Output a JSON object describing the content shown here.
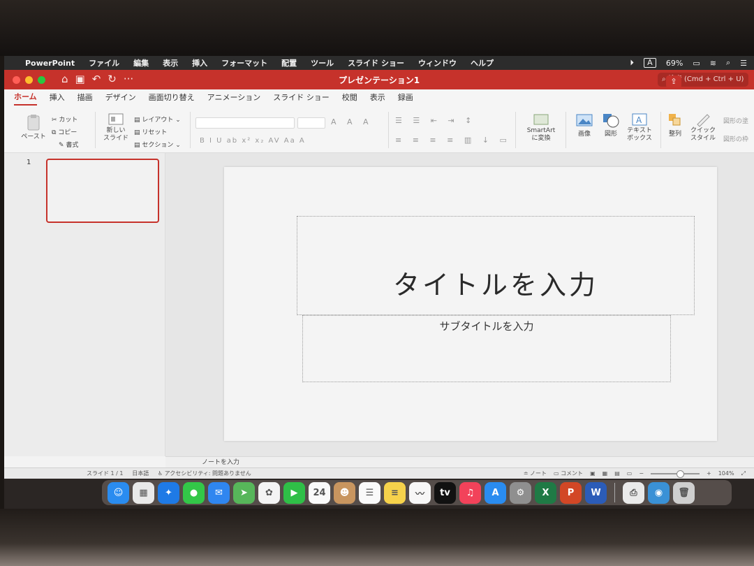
{
  "menubar": {
    "app_name": "PowerPoint",
    "items": [
      "ファイル",
      "編集",
      "表示",
      "挿入",
      "フォーマット",
      "配置",
      "ツール",
      "スライド ショー",
      "ウィンドウ",
      "ヘルプ"
    ],
    "input_indicator": "A",
    "battery": "69%"
  },
  "titlebar": {
    "document_title": "プレゼンテーション1",
    "search_placeholder": "検索 (Cmd + Ctrl + U)",
    "colors": {
      "accent": "#c6322b"
    }
  },
  "ribbon": {
    "tabs": [
      "ホーム",
      "挿入",
      "描画",
      "デザイン",
      "画面切り替え",
      "アニメーション",
      "スライド ショー",
      "校閲",
      "表示",
      "録画"
    ],
    "active_tab": "ホーム",
    "clipboard": {
      "paste": "ペースト",
      "cut": "カット",
      "copy": "コピー",
      "format": "書式"
    },
    "slides": {
      "new_slide_line1": "新しい",
      "new_slide_line2": "スライド",
      "layout": "レイアウト",
      "reset": "リセット",
      "section": "セクション"
    },
    "font_tools": "B  I  U  ab  x²  x₂  AV  Aa  A",
    "smartart_line1": "SmartArt",
    "smartart_line2": "に変換",
    "picture": "画像",
    "shape": "図形",
    "textbox_line1": "テキスト",
    "textbox_line2": "ボックス",
    "arrange": "整列",
    "quick_style_line1": "クイック",
    "quick_style_line2": "スタイル",
    "shape_fill": "図形の塗",
    "shape_outline": "図形の枠"
  },
  "thumbnails": {
    "slide_number": "1"
  },
  "slide": {
    "title_placeholder": "タイトルを入力",
    "subtitle_placeholder": "サブタイトルを入力"
  },
  "notes": {
    "placeholder": "ノートを入力"
  },
  "statusbar": {
    "slide_position": "スライド 1 / 1",
    "language": "日本語",
    "accessibility": "アクセシビリティ: 問題ありません",
    "notes_btn": "ノート",
    "comments_btn": "コメント",
    "zoom": "104%",
    "zoom_fraction": 0.6
  },
  "dock": {
    "items": [
      {
        "name": "finder-icon",
        "color": "#2a8cf0",
        "glyph": "☺"
      },
      {
        "name": "launchpad-icon",
        "color": "#e9e9e9",
        "glyph": "▦"
      },
      {
        "name": "safari-icon",
        "color": "#1e7ae6",
        "glyph": "✦"
      },
      {
        "name": "messages-icon",
        "color": "#33c748",
        "glyph": "●"
      },
      {
        "name": "mail-icon",
        "color": "#2f86f0",
        "glyph": "✉"
      },
      {
        "name": "maps-icon",
        "color": "#57b65a",
        "glyph": "➤"
      },
      {
        "name": "photos-icon",
        "color": "#f4f4f4",
        "glyph": "✿"
      },
      {
        "name": "facetime-icon",
        "color": "#2fbf47",
        "glyph": "▶"
      },
      {
        "name": "calendar-icon",
        "color": "#fafafa",
        "glyph": "24"
      },
      {
        "name": "contacts-icon",
        "color": "#c8955f",
        "glyph": "☻"
      },
      {
        "name": "reminders-icon",
        "color": "#fafafa",
        "glyph": "☰"
      },
      {
        "name": "notes-icon",
        "color": "#f6d24b",
        "glyph": "≡"
      },
      {
        "name": "freeform-icon",
        "color": "#f7f7f7",
        "glyph": "〰"
      },
      {
        "name": "appletv-icon",
        "color": "#111111",
        "glyph": "tv"
      },
      {
        "name": "music-icon",
        "color": "#f2425a",
        "glyph": "♫"
      },
      {
        "name": "appstore-icon",
        "color": "#2a8cf0",
        "glyph": "A"
      },
      {
        "name": "settings-icon",
        "color": "#8f8f8f",
        "glyph": "⚙"
      },
      {
        "name": "excel-icon",
        "color": "#1f7a45",
        "glyph": "X"
      },
      {
        "name": "powerpoint-icon",
        "color": "#d24726",
        "glyph": "P"
      },
      {
        "name": "word-icon",
        "color": "#2b5cb8",
        "glyph": "W"
      }
    ],
    "extras": [
      {
        "name": "printer-icon",
        "color": "#eaeaea",
        "glyph": "⎙"
      },
      {
        "name": "downloads-icon",
        "color": "#3a91d6",
        "glyph": "◉"
      },
      {
        "name": "trash-icon",
        "color": "#cfcfcf",
        "glyph": "🗑"
      }
    ]
  }
}
